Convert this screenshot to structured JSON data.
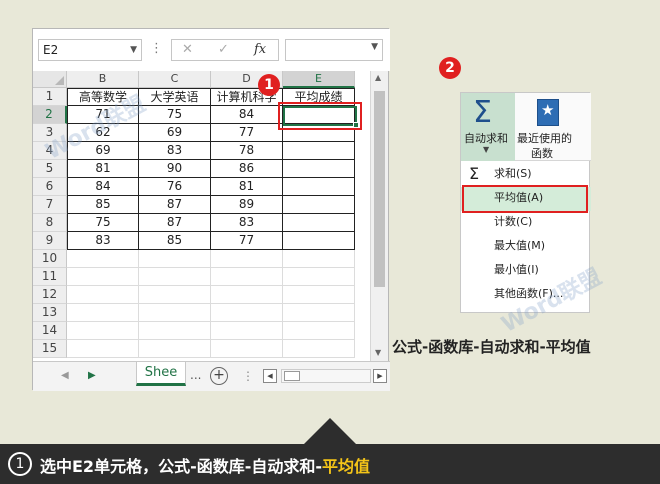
{
  "excel": {
    "name_box": "E2",
    "fx_symbol": "fx",
    "cancel_symbol": "✕",
    "enter_symbol": "✓",
    "columns": [
      "B",
      "C",
      "D",
      "E"
    ],
    "headers": [
      "高等数学",
      "大学英语",
      "计算机科学",
      "平均成绩"
    ],
    "rows": [
      "1",
      "2",
      "3",
      "4",
      "5",
      "6",
      "7",
      "8",
      "9",
      "10",
      "11",
      "12",
      "13",
      "14",
      "15"
    ],
    "data": [
      [
        "71",
        "75",
        "84",
        ""
      ],
      [
        "62",
        "69",
        "77",
        ""
      ],
      [
        "69",
        "83",
        "78",
        ""
      ],
      [
        "81",
        "90",
        "86",
        ""
      ],
      [
        "84",
        "76",
        "81",
        ""
      ],
      [
        "85",
        "87",
        "89",
        ""
      ],
      [
        "75",
        "87",
        "83",
        ""
      ],
      [
        "83",
        "85",
        "77",
        ""
      ]
    ],
    "sheet_tab": "Shee",
    "tab_ellipsis": "...",
    "add_sheet": "+"
  },
  "badges": {
    "one": "1",
    "two": "2"
  },
  "ribbon": {
    "autosum_label": "自动求和",
    "recent_label_1": "最近使用的",
    "recent_label_2": "函数",
    "menu": [
      {
        "label": "求和(S)",
        "icon": "Σ"
      },
      {
        "label": "平均值(A)",
        "icon": ""
      },
      {
        "label": "计数(C)",
        "icon": ""
      },
      {
        "label": "最大值(M)",
        "icon": ""
      },
      {
        "label": "最小值(I)",
        "icon": ""
      },
      {
        "label": "其他函数(F)...",
        "icon": ""
      }
    ]
  },
  "captions": {
    "right": "公式-函数库-自动求和-平均值",
    "step": "1",
    "bottom_main": "选中E2单元格，公式-函数库-自动求和-",
    "bottom_highlight": "平均值"
  },
  "watermark": "Word联盟",
  "colors": {
    "excel_green": "#217346",
    "red_highlight": "#e02020",
    "bottom_bar": "#2d2d2d",
    "highlight_text": "#f5c518"
  }
}
